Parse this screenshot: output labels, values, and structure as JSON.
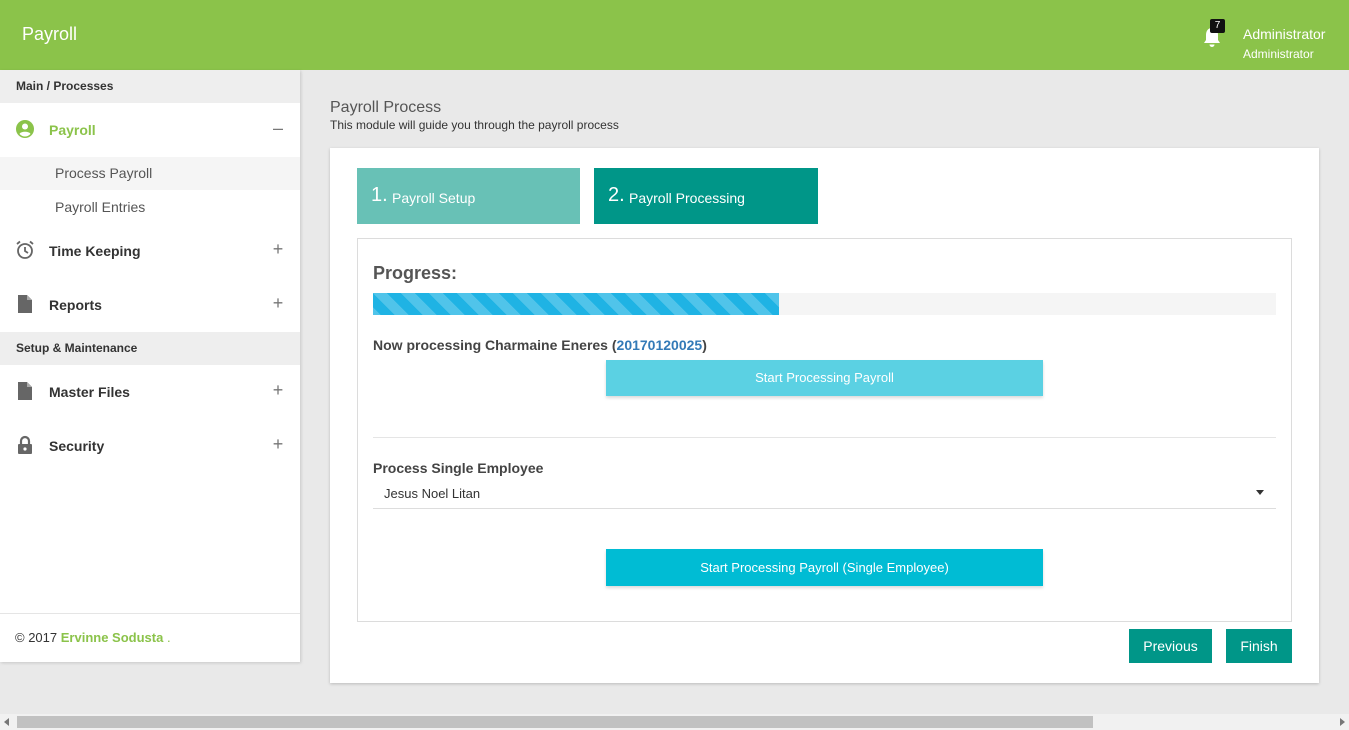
{
  "app": {
    "title": "Payroll"
  },
  "header": {
    "notification_count": "7",
    "user_name": "Administrator",
    "user_role": "Administrator"
  },
  "sidebar": {
    "section_main": "Main / Processes",
    "section_setup": "Setup & Maintenance",
    "payroll": {
      "label": "Payroll",
      "toggle": "–"
    },
    "sub_items": [
      {
        "label": "Process Payroll"
      },
      {
        "label": "Payroll Entries"
      }
    ],
    "time_keeping": {
      "label": "Time Keeping",
      "toggle": "+"
    },
    "reports": {
      "label": "Reports",
      "toggle": "+"
    },
    "master_files": {
      "label": "Master Files",
      "toggle": "+"
    },
    "security": {
      "label": "Security",
      "toggle": "+"
    },
    "footer": {
      "copyright": "© 2017",
      "author": "Ervinne Sodusta",
      "dot": "."
    }
  },
  "page": {
    "title": "Payroll Process",
    "subtitle": "This module will guide you through the payroll process"
  },
  "steps": [
    {
      "number": "1.",
      "label": "Payroll Setup"
    },
    {
      "number": "2.",
      "label": "Payroll Processing"
    }
  ],
  "progress": {
    "label": "Progress:",
    "percent": 45,
    "now_processing_prefix": "Now processing Charmaine Eneres (",
    "employee_id": "20170120025",
    "now_processing_suffix": ")",
    "start_button": "Start Processing Payroll"
  },
  "single": {
    "label": "Process Single Employee",
    "selected_employee": "Jesus Noel Litan",
    "start_button": "Start Processing Payroll (Single Employee)"
  },
  "nav_buttons": {
    "previous": "Previous",
    "finish": "Finish"
  },
  "colors": {
    "brand": "#8bc34a",
    "step_inactive": "#68c1b6",
    "step_active": "#009688",
    "progress": "#1fb3e4",
    "button_light": "#5bd1e3",
    "button_cyan": "#00bcd4"
  }
}
